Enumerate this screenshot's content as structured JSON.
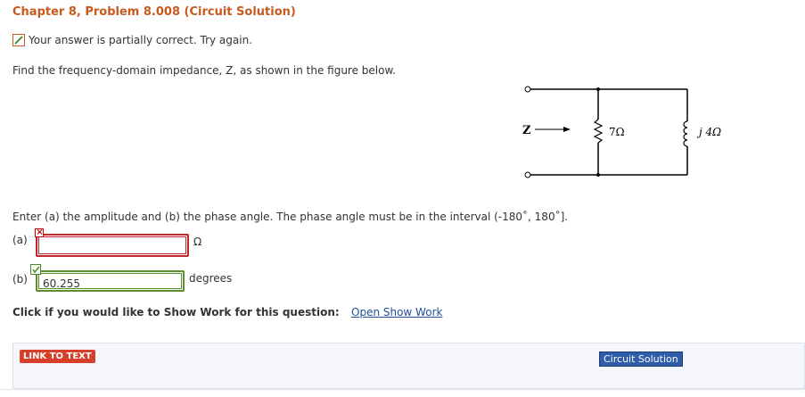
{
  "header": {
    "title": "Chapter 8, Problem 8.008 (Circuit Solution)"
  },
  "status": {
    "message": "Your answer is partially correct.  Try again."
  },
  "question": {
    "prompt": "Find the frequency-domain impedance, Z, as shown in the figure below.",
    "instructions": "Enter (a) the amplitude and (b) the phase angle. The phase angle must be in the interval (-180˚, 180˚]."
  },
  "answers": {
    "a": {
      "label": "(a)",
      "value": "",
      "unit": "Ω",
      "status": "incorrect"
    },
    "b": {
      "label": "(b)",
      "value": "60.255",
      "unit": "degrees",
      "status": "correct"
    }
  },
  "show_work": {
    "text": "Click if you would like to Show Work for this question:",
    "link": "Open Show Work"
  },
  "circuit": {
    "z_label": "Z",
    "r_label": "7Ω",
    "l_label": "j 4Ω"
  },
  "footer": {
    "link_to_text": "LINK TO TEXT",
    "circuit_solution": "Circuit Solution"
  },
  "colors": {
    "title": "#c75a1c",
    "error": "#c0272d",
    "correct": "#5a8f2f",
    "link": "#1f4f9a",
    "button_red": "#d6402a",
    "button_blue": "#2f5da8"
  }
}
